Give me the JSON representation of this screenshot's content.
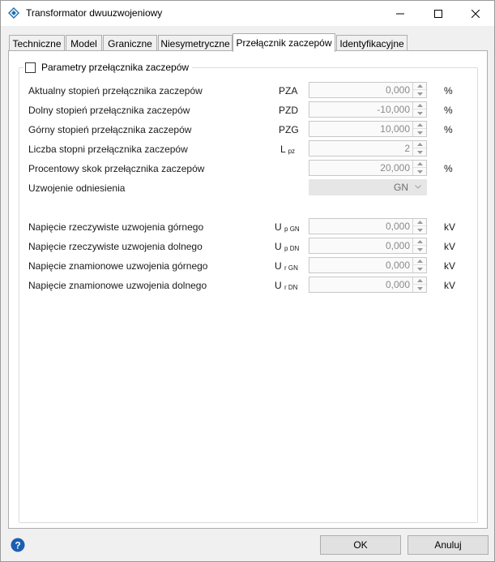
{
  "window": {
    "title": "Transformator dwuuzwojeniowy",
    "app_icon": "diamond-transformer-icon",
    "controls": {
      "minimize": "minimize-icon",
      "maximize": "maximize-icon",
      "close": "close-icon"
    }
  },
  "tabs": [
    {
      "label": "Techniczne",
      "active": false
    },
    {
      "label": "Model",
      "active": false
    },
    {
      "label": "Graniczne",
      "active": false
    },
    {
      "label": "Niesymetryczne",
      "active": false
    },
    {
      "label": "Przełącznik zaczepów",
      "active": true
    },
    {
      "label": "Identyfikacyjne",
      "active": false
    }
  ],
  "group": {
    "checkbox_label": "Parametry przełącznika zaczepów",
    "checked": false
  },
  "rows": [
    {
      "label": "Aktualny stopień przełącznika zaczepów",
      "symbol": "PZA",
      "symbol_sub": "",
      "value": "0,000",
      "unit": "%"
    },
    {
      "label": "Dolny stopień przełącznika zaczepów",
      "symbol": "PZD",
      "symbol_sub": "",
      "value": "-10,000",
      "unit": "%"
    },
    {
      "label": "Górny stopień przełącznika zaczepów",
      "symbol": "PZG",
      "symbol_sub": "",
      "value": "10,000",
      "unit": "%"
    },
    {
      "label": "Liczba stopni przełącznika zaczepów",
      "symbol": "L",
      "symbol_sub": "pz",
      "value": "2",
      "unit": ""
    },
    {
      "label": "Procentowy skok przełącznika zaczepów",
      "symbol": "",
      "symbol_sub": "",
      "value": "20,000",
      "unit": "%"
    }
  ],
  "reference_winding": {
    "label": "Uzwojenie odniesienia",
    "value": "GN"
  },
  "voltage_rows": [
    {
      "label": "Napięcie rzeczywiste uzwojenia górnego",
      "symbol": "U",
      "symbol_sub": "p GN",
      "value": "0,000",
      "unit": "kV"
    },
    {
      "label": "Napięcie rzeczywiste uzwojenia dolnego",
      "symbol": "U",
      "symbol_sub": "p DN",
      "value": "0,000",
      "unit": "kV"
    },
    {
      "label": "Napięcie znamionowe uzwojenia górnego",
      "symbol": "U",
      "symbol_sub": "r GN",
      "value": "0,000",
      "unit": "kV"
    },
    {
      "label": "Napięcie znamionowe uzwojenia dolnego",
      "symbol": "U",
      "symbol_sub": "r DN",
      "value": "0,000",
      "unit": "kV"
    }
  ],
  "footer": {
    "help_icon": "help-icon",
    "ok_label": "OK",
    "cancel_label": "Anuluj"
  }
}
